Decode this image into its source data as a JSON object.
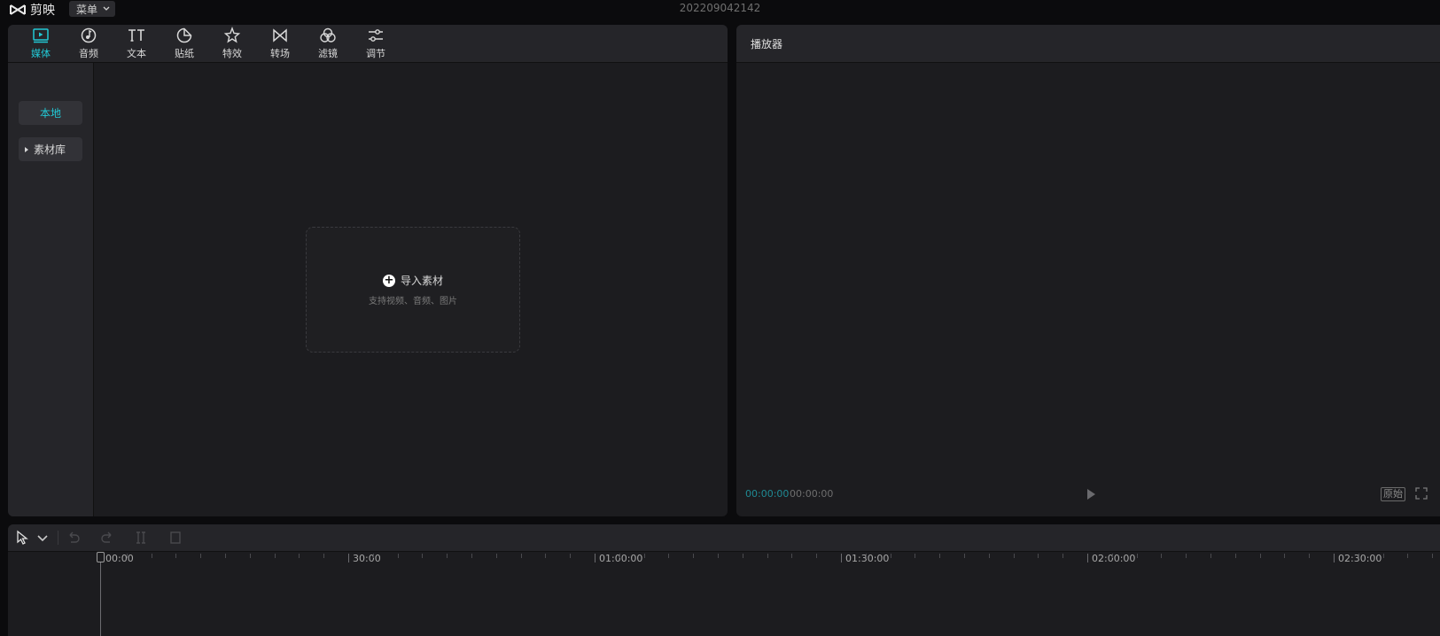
{
  "app": {
    "name": "剪映",
    "menu_label": "菜单",
    "project_title": "202209042142"
  },
  "media_tabs": [
    {
      "label": "媒体",
      "icon": "media-icon",
      "active": true
    },
    {
      "label": "音频",
      "icon": "audio-icon",
      "active": false
    },
    {
      "label": "文本",
      "icon": "text-icon",
      "active": false
    },
    {
      "label": "贴纸",
      "icon": "sticker-icon",
      "active": false
    },
    {
      "label": "特效",
      "icon": "effects-icon",
      "active": false
    },
    {
      "label": "转场",
      "icon": "transition-icon",
      "active": false
    },
    {
      "label": "滤镜",
      "icon": "filter-icon",
      "active": false
    },
    {
      "label": "调节",
      "icon": "adjust-icon",
      "active": false
    }
  ],
  "sidebar": {
    "local_label": "本地",
    "library_label": "素材库"
  },
  "dropzone": {
    "import_label": "导入素材",
    "sub_label": "支持视频、音频、图片"
  },
  "player": {
    "title": "播放器",
    "current_time": "00:00:00",
    "total_time": "00:00:00",
    "ratio_label": "原始"
  },
  "timeline": {
    "ticks": [
      "00:00",
      "30:00",
      "01:00:00",
      "01:30:00",
      "02:00:00",
      "02:30:00"
    ]
  },
  "colors": {
    "accent": "#22c9d6",
    "panel": "#1c1c1f",
    "panel_header": "#252529",
    "background": "#0b0b0d"
  }
}
